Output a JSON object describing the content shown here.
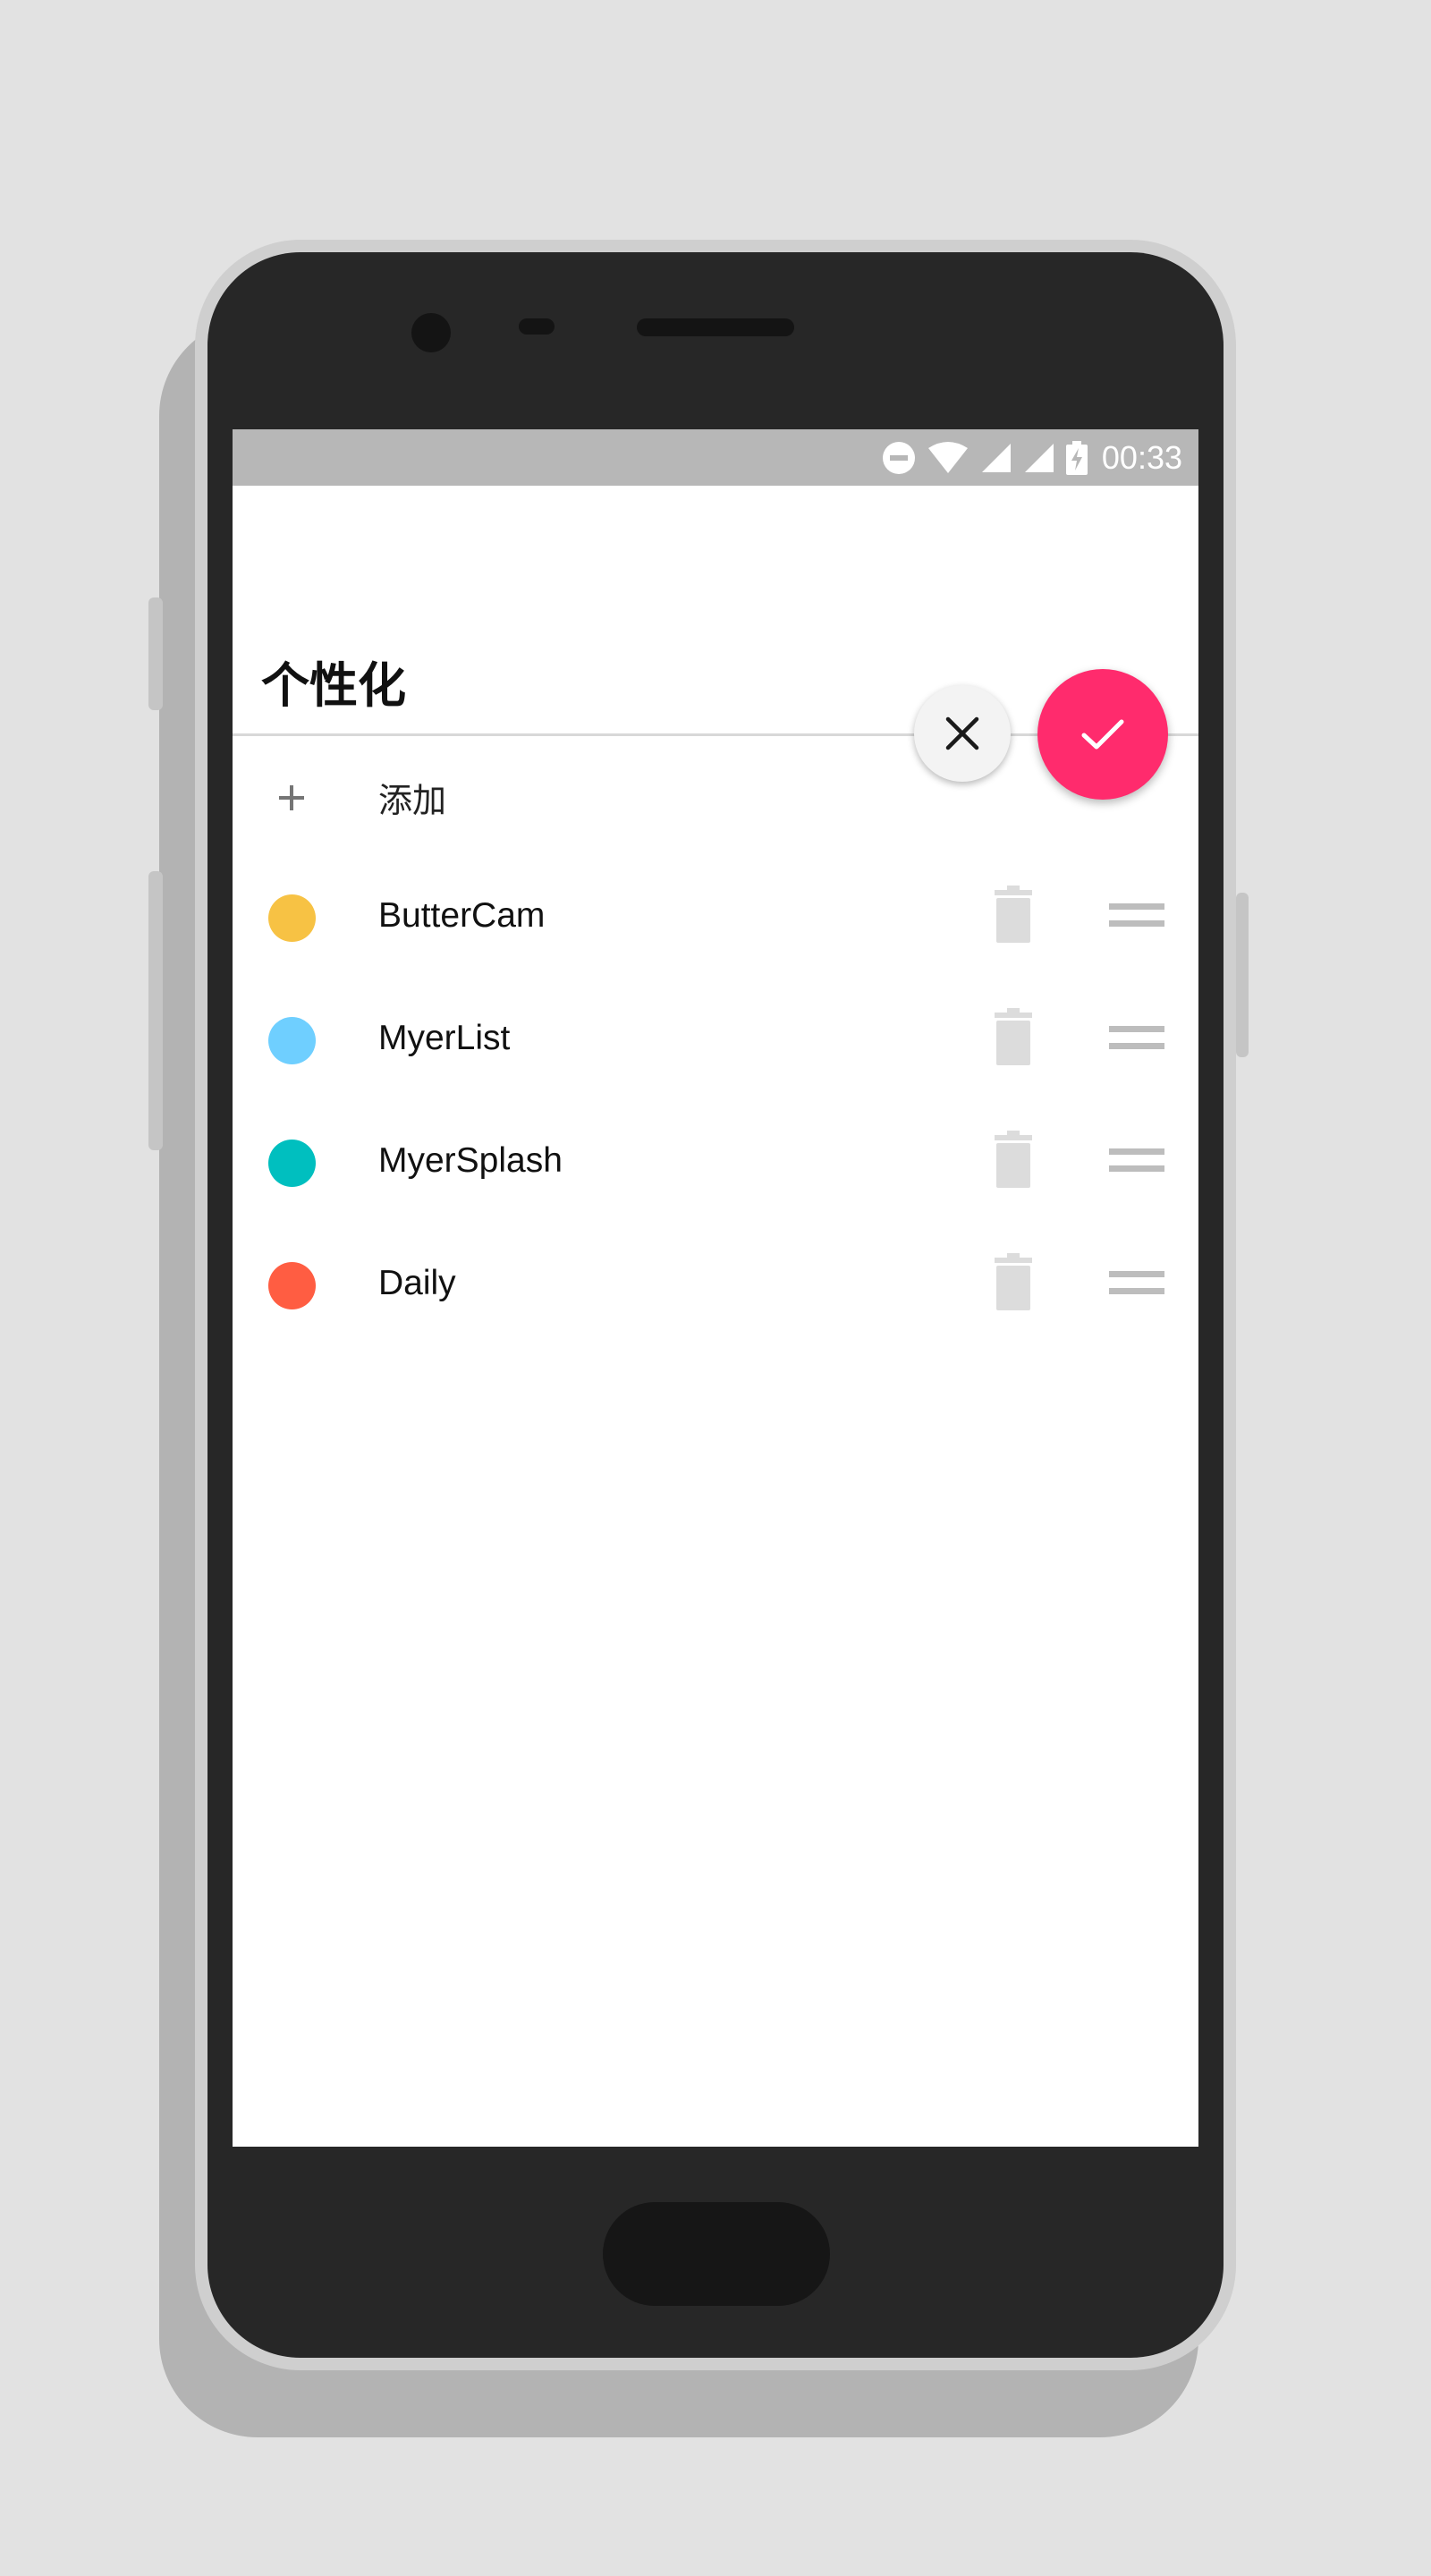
{
  "status_bar": {
    "time": "00:33",
    "icons": [
      "do-not-disturb-icon",
      "wifi-icon",
      "signal-icon",
      "signal-icon",
      "battery-charging-icon"
    ]
  },
  "page": {
    "title": "个性化"
  },
  "actions": {
    "cancel_icon": "close-icon",
    "confirm_icon": "check-icon",
    "confirm_color": "#ff2b6d"
  },
  "add_row": {
    "icon": "plus-icon",
    "label": "添加"
  },
  "items": [
    {
      "label": "ButterCam",
      "color": "#f7c244"
    },
    {
      "label": "MyerList",
      "color": "#6fcfff"
    },
    {
      "label": "MyerSplash",
      "color": "#00bfbf"
    },
    {
      "label": "Daily",
      "color": "#ff5d42"
    }
  ]
}
